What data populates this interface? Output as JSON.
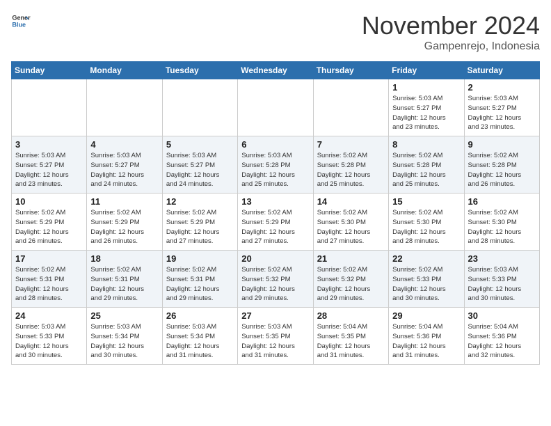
{
  "logo": {
    "line1": "General",
    "line2": "Blue"
  },
  "title": "November 2024",
  "location": "Gampenrejo, Indonesia",
  "days_of_week": [
    "Sunday",
    "Monday",
    "Tuesday",
    "Wednesday",
    "Thursday",
    "Friday",
    "Saturday"
  ],
  "weeks": [
    [
      {
        "day": "",
        "info": ""
      },
      {
        "day": "",
        "info": ""
      },
      {
        "day": "",
        "info": ""
      },
      {
        "day": "",
        "info": ""
      },
      {
        "day": "",
        "info": ""
      },
      {
        "day": "1",
        "info": "Sunrise: 5:03 AM\nSunset: 5:27 PM\nDaylight: 12 hours\nand 23 minutes."
      },
      {
        "day": "2",
        "info": "Sunrise: 5:03 AM\nSunset: 5:27 PM\nDaylight: 12 hours\nand 23 minutes."
      }
    ],
    [
      {
        "day": "3",
        "info": "Sunrise: 5:03 AM\nSunset: 5:27 PM\nDaylight: 12 hours\nand 23 minutes."
      },
      {
        "day": "4",
        "info": "Sunrise: 5:03 AM\nSunset: 5:27 PM\nDaylight: 12 hours\nand 24 minutes."
      },
      {
        "day": "5",
        "info": "Sunrise: 5:03 AM\nSunset: 5:27 PM\nDaylight: 12 hours\nand 24 minutes."
      },
      {
        "day": "6",
        "info": "Sunrise: 5:03 AM\nSunset: 5:28 PM\nDaylight: 12 hours\nand 25 minutes."
      },
      {
        "day": "7",
        "info": "Sunrise: 5:02 AM\nSunset: 5:28 PM\nDaylight: 12 hours\nand 25 minutes."
      },
      {
        "day": "8",
        "info": "Sunrise: 5:02 AM\nSunset: 5:28 PM\nDaylight: 12 hours\nand 25 minutes."
      },
      {
        "day": "9",
        "info": "Sunrise: 5:02 AM\nSunset: 5:28 PM\nDaylight: 12 hours\nand 26 minutes."
      }
    ],
    [
      {
        "day": "10",
        "info": "Sunrise: 5:02 AM\nSunset: 5:29 PM\nDaylight: 12 hours\nand 26 minutes."
      },
      {
        "day": "11",
        "info": "Sunrise: 5:02 AM\nSunset: 5:29 PM\nDaylight: 12 hours\nand 26 minutes."
      },
      {
        "day": "12",
        "info": "Sunrise: 5:02 AM\nSunset: 5:29 PM\nDaylight: 12 hours\nand 27 minutes."
      },
      {
        "day": "13",
        "info": "Sunrise: 5:02 AM\nSunset: 5:29 PM\nDaylight: 12 hours\nand 27 minutes."
      },
      {
        "day": "14",
        "info": "Sunrise: 5:02 AM\nSunset: 5:30 PM\nDaylight: 12 hours\nand 27 minutes."
      },
      {
        "day": "15",
        "info": "Sunrise: 5:02 AM\nSunset: 5:30 PM\nDaylight: 12 hours\nand 28 minutes."
      },
      {
        "day": "16",
        "info": "Sunrise: 5:02 AM\nSunset: 5:30 PM\nDaylight: 12 hours\nand 28 minutes."
      }
    ],
    [
      {
        "day": "17",
        "info": "Sunrise: 5:02 AM\nSunset: 5:31 PM\nDaylight: 12 hours\nand 28 minutes."
      },
      {
        "day": "18",
        "info": "Sunrise: 5:02 AM\nSunset: 5:31 PM\nDaylight: 12 hours\nand 29 minutes."
      },
      {
        "day": "19",
        "info": "Sunrise: 5:02 AM\nSunset: 5:31 PM\nDaylight: 12 hours\nand 29 minutes."
      },
      {
        "day": "20",
        "info": "Sunrise: 5:02 AM\nSunset: 5:32 PM\nDaylight: 12 hours\nand 29 minutes."
      },
      {
        "day": "21",
        "info": "Sunrise: 5:02 AM\nSunset: 5:32 PM\nDaylight: 12 hours\nand 29 minutes."
      },
      {
        "day": "22",
        "info": "Sunrise: 5:02 AM\nSunset: 5:33 PM\nDaylight: 12 hours\nand 30 minutes."
      },
      {
        "day": "23",
        "info": "Sunrise: 5:03 AM\nSunset: 5:33 PM\nDaylight: 12 hours\nand 30 minutes."
      }
    ],
    [
      {
        "day": "24",
        "info": "Sunrise: 5:03 AM\nSunset: 5:33 PM\nDaylight: 12 hours\nand 30 minutes."
      },
      {
        "day": "25",
        "info": "Sunrise: 5:03 AM\nSunset: 5:34 PM\nDaylight: 12 hours\nand 30 minutes."
      },
      {
        "day": "26",
        "info": "Sunrise: 5:03 AM\nSunset: 5:34 PM\nDaylight: 12 hours\nand 31 minutes."
      },
      {
        "day": "27",
        "info": "Sunrise: 5:03 AM\nSunset: 5:35 PM\nDaylight: 12 hours\nand 31 minutes."
      },
      {
        "day": "28",
        "info": "Sunrise: 5:04 AM\nSunset: 5:35 PM\nDaylight: 12 hours\nand 31 minutes."
      },
      {
        "day": "29",
        "info": "Sunrise: 5:04 AM\nSunset: 5:36 PM\nDaylight: 12 hours\nand 31 minutes."
      },
      {
        "day": "30",
        "info": "Sunrise: 5:04 AM\nSunset: 5:36 PM\nDaylight: 12 hours\nand 32 minutes."
      }
    ]
  ]
}
